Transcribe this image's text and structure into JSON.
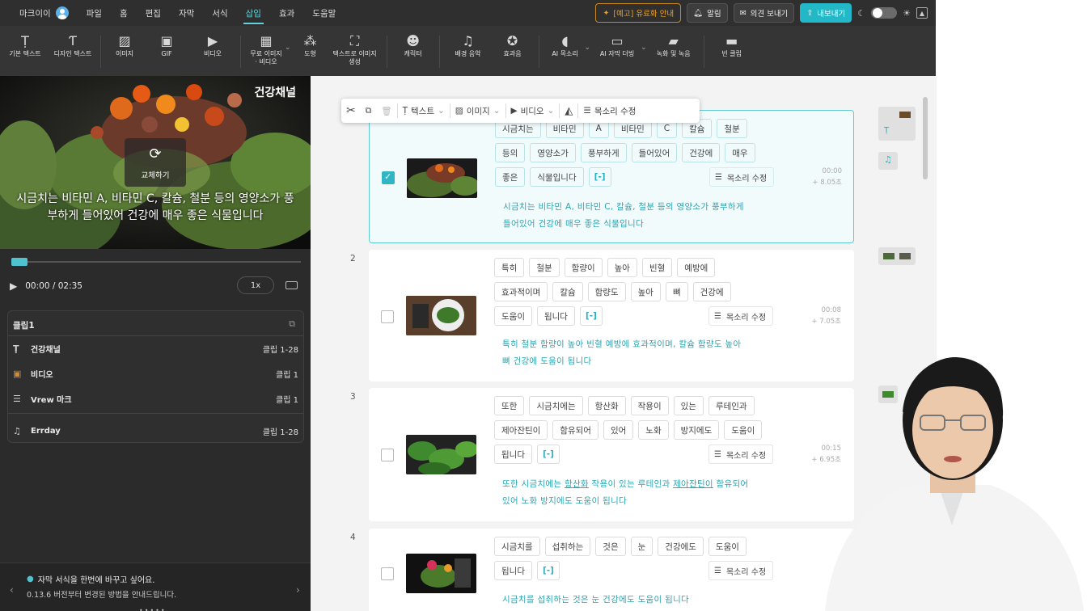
{
  "menubar": {
    "items": [
      "마크이이",
      "파일",
      "홈",
      "편집",
      "자막",
      "서식",
      "삽입",
      "효과",
      "도움말"
    ],
    "active_index": 6,
    "notice_label": "[예고] 유료화 안내",
    "alarm_label": "알림",
    "feedback_label": "의견 보내기",
    "export_label": "내보내기"
  },
  "toolbar": {
    "basic_text": "기본 텍스트",
    "design_text": "디자인 텍스트",
    "image": "이미지",
    "gif": "GIF",
    "video": "비디오",
    "free_media_1": "무료 이미지",
    "free_media_2": "· 비디오",
    "shape": "도형",
    "text_to_image_1": "텍스트로 이미지",
    "text_to_image_2": "생성",
    "character": "캐릭터",
    "bgm": "배경 음악",
    "sfx": "효과음",
    "ai_voice": "AI 목소리",
    "ai_dubbing": "AI 자막 더빙",
    "record": "녹화 및 녹음",
    "empty_clip": "빈 클립"
  },
  "preview": {
    "channel": "건강채널",
    "replace_label": "교체하기",
    "subtitle_1": "시금치는 비타민 A, 비타민 C, 칼슘, 철분 등의 영양소가 풍",
    "subtitle_2": "부하게 들어있어 건강에 매우 좋은 식물입니다"
  },
  "player": {
    "time": "00:00 / 02:35",
    "speed": "1x",
    "progress": 0.0
  },
  "clip_panel": {
    "title": "클립1",
    "rows": [
      {
        "icon": "text-icon",
        "label": "건강채널",
        "range": "클립 1-28"
      },
      {
        "icon": "video-icon",
        "label": "비디오",
        "range": "클립 1"
      },
      {
        "icon": "watermark-icon",
        "label": "Vrew 마크",
        "range": "클립 1"
      },
      {
        "icon": "music-icon",
        "label": "Errday",
        "range": "클립 1-28"
      }
    ]
  },
  "tip": {
    "line1": "자막 서식을 한번에 바꾸고 싶어요.",
    "line2": "0.13.6 버전부터 변경된 방법을 안내드립니다."
  },
  "float_toolbar": {
    "text": "텍스트",
    "image": "이미지",
    "video": "비디오",
    "voice": "목소리 수정"
  },
  "voice_edit_label": "목소리 수정",
  "clips": [
    {
      "num": "",
      "checked": true,
      "words": [
        "시금치는",
        "비타민",
        "A",
        "비타민",
        "C",
        "칼슘",
        "철분",
        "등의",
        "영양소가",
        "풍부하게",
        "들어있어",
        "건강에",
        "매우",
        "좋은",
        "식물입니다",
        "[-]"
      ],
      "start": "00:00",
      "duration": "+ 8.05초",
      "subtitle_1": "시금치는 비타민 A, 비타민 C, 칼슘, 철분 등의 영양소가 풍부하게",
      "subtitle_2": "들어있어 건강에 매우 좋은 식물입니다"
    },
    {
      "num": "2",
      "checked": false,
      "words": [
        "특히",
        "철분",
        "함량이",
        "높아",
        "빈혈",
        "예방에",
        "효과적이며",
        "칼슘",
        "함량도",
        "높아",
        "뼈",
        "건강에",
        "도움이",
        "됩니다",
        "[-]"
      ],
      "start": "00:08",
      "duration": "+ 7.05초",
      "subtitle_1": "특히 철분 함량이 높아 빈혈 예방에 효과적이며, 칼슘 함량도 높아",
      "subtitle_2": "뼈 건강에 도움이 됩니다"
    },
    {
      "num": "3",
      "checked": false,
      "words": [
        "또한",
        "시금치에는",
        "항산화",
        "작용이",
        "있는",
        "루테인과",
        "제아잔틴이",
        "함유되어",
        "있어",
        "노화",
        "방지에도",
        "도움이",
        "됩니다",
        "[-]"
      ],
      "start": "00:15",
      "duration": "+ 6.95초",
      "subtitle_1a": "또한 시금치에는 ",
      "subtitle_1b": "항산화",
      "subtitle_1c": " 작용이 있는 루테인과 ",
      "subtitle_1d": "제아잔틴이",
      "subtitle_1e": " 함유되어",
      "subtitle_2": "있어 노화 방지에도 도움이 됩니다"
    },
    {
      "num": "4",
      "checked": false,
      "words": [
        "시금치를",
        "섭취하는",
        "것은",
        "눈",
        "건강에도",
        "도움이",
        "됩니다",
        "[-]"
      ],
      "subtitle_1": "시금치를 섭취하는 것은 눈 건강에도 도움이 됩니다"
    }
  ]
}
